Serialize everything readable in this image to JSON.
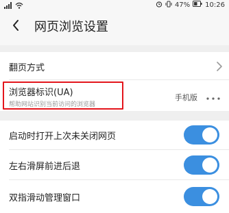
{
  "status_bar": {
    "battery": "47%",
    "time": "10:26"
  },
  "header": {
    "title": "网页浏览设置"
  },
  "settings": {
    "page_turn": {
      "label": "翻页方式"
    },
    "user_agent": {
      "label": "浏览器标识(UA)",
      "subtitle": "帮助网站识别当前访问的浏览器",
      "value": "手机版"
    },
    "toggles": [
      {
        "label": "启动时打开上次未关闭网页",
        "on": true
      },
      {
        "label": "左右滑屏前进后退",
        "on": true
      },
      {
        "label": "双指滑动管理窗口",
        "on": true
      }
    ]
  },
  "colors": {
    "accent": "#3b8fe0",
    "highlight": "#e3141b"
  }
}
